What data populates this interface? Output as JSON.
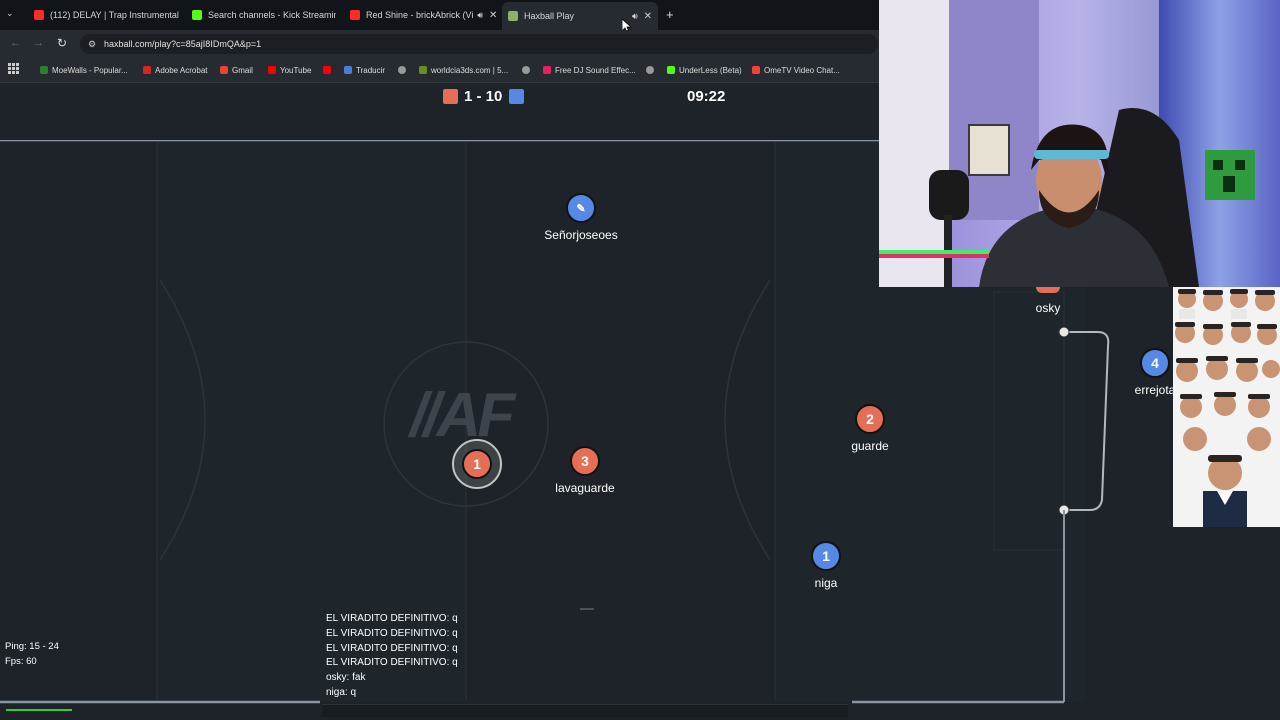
{
  "browser": {
    "tabs": [
      {
        "title": "(112) DELAY | Trap Instrumental",
        "icon_color": "#ff2b2b"
      },
      {
        "title": "Search channels - Kick Streaming",
        "icon_color": "#53fc18"
      },
      {
        "title": "Red Shine - brickAbrick (Vi",
        "icon_color": "#ff2b2b"
      },
      {
        "title": "Haxball Play",
        "icon_color": "#8fb06a"
      }
    ],
    "new_tab_symbol": "+",
    "url": "haxball.com/play?c=85ajI8IDmQA&p=1",
    "bookmarks": [
      {
        "label": "MoeWalls - Popular...",
        "icon_color": "#2f7d32"
      },
      {
        "label": "Adobe Acrobat",
        "icon_color": "#d9261c"
      },
      {
        "label": "Gmail",
        "icon_color": "#ea4335"
      },
      {
        "label": "YouTube",
        "icon_color": "#ff0000"
      },
      {
        "label": "",
        "icon_color": "#ff0000"
      },
      {
        "label": "Traducir",
        "icon_color": "#4a7dd8"
      },
      {
        "label": "",
        "icon_color": "#9a9a9a"
      },
      {
        "label": "worldcia3ds.com | 5...",
        "icon_color": "#6b8e23"
      },
      {
        "label": "",
        "icon_color": "#9a9a9a"
      },
      {
        "label": "Free DJ Sound Effec...",
        "icon_color": "#e91e63"
      },
      {
        "label": "",
        "icon_color": "#9a9a9a"
      },
      {
        "label": "UnderLess (Beta)",
        "icon_color": "#53fc18"
      },
      {
        "label": "OmeTV Video Chat...",
        "icon_color": "#f44336"
      }
    ]
  },
  "game": {
    "score": "1 - 10",
    "timer": "09:22",
    "red_color": "#e56e56",
    "blue_color": "#5689e5",
    "center_logo": "//AF",
    "players": [
      {
        "name": "Señorjoseoes",
        "number": "",
        "team": "blue"
      },
      {
        "name": "lavaguarde",
        "number": "3",
        "team": "red"
      },
      {
        "name": "",
        "number": "1",
        "team": "red"
      },
      {
        "name": "guarde",
        "number": "2",
        "team": "red"
      },
      {
        "name": "niga",
        "number": "1",
        "team": "blue"
      },
      {
        "name": "errejota",
        "number": "4",
        "team": "blue"
      },
      {
        "name": "osky",
        "number": "",
        "team": "red"
      }
    ],
    "chat": [
      "EL VIRADITO DEFINITIVO: q",
      "EL VIRADITO DEFINITIVO: q",
      "EL VIRADITO DEFINITIVO: q",
      "EL VIRADITO DEFINITIVO: q",
      "osky: fak",
      "niga: q"
    ],
    "ping": "Ping: 15 - 24",
    "fps": "Fps: 60"
  }
}
